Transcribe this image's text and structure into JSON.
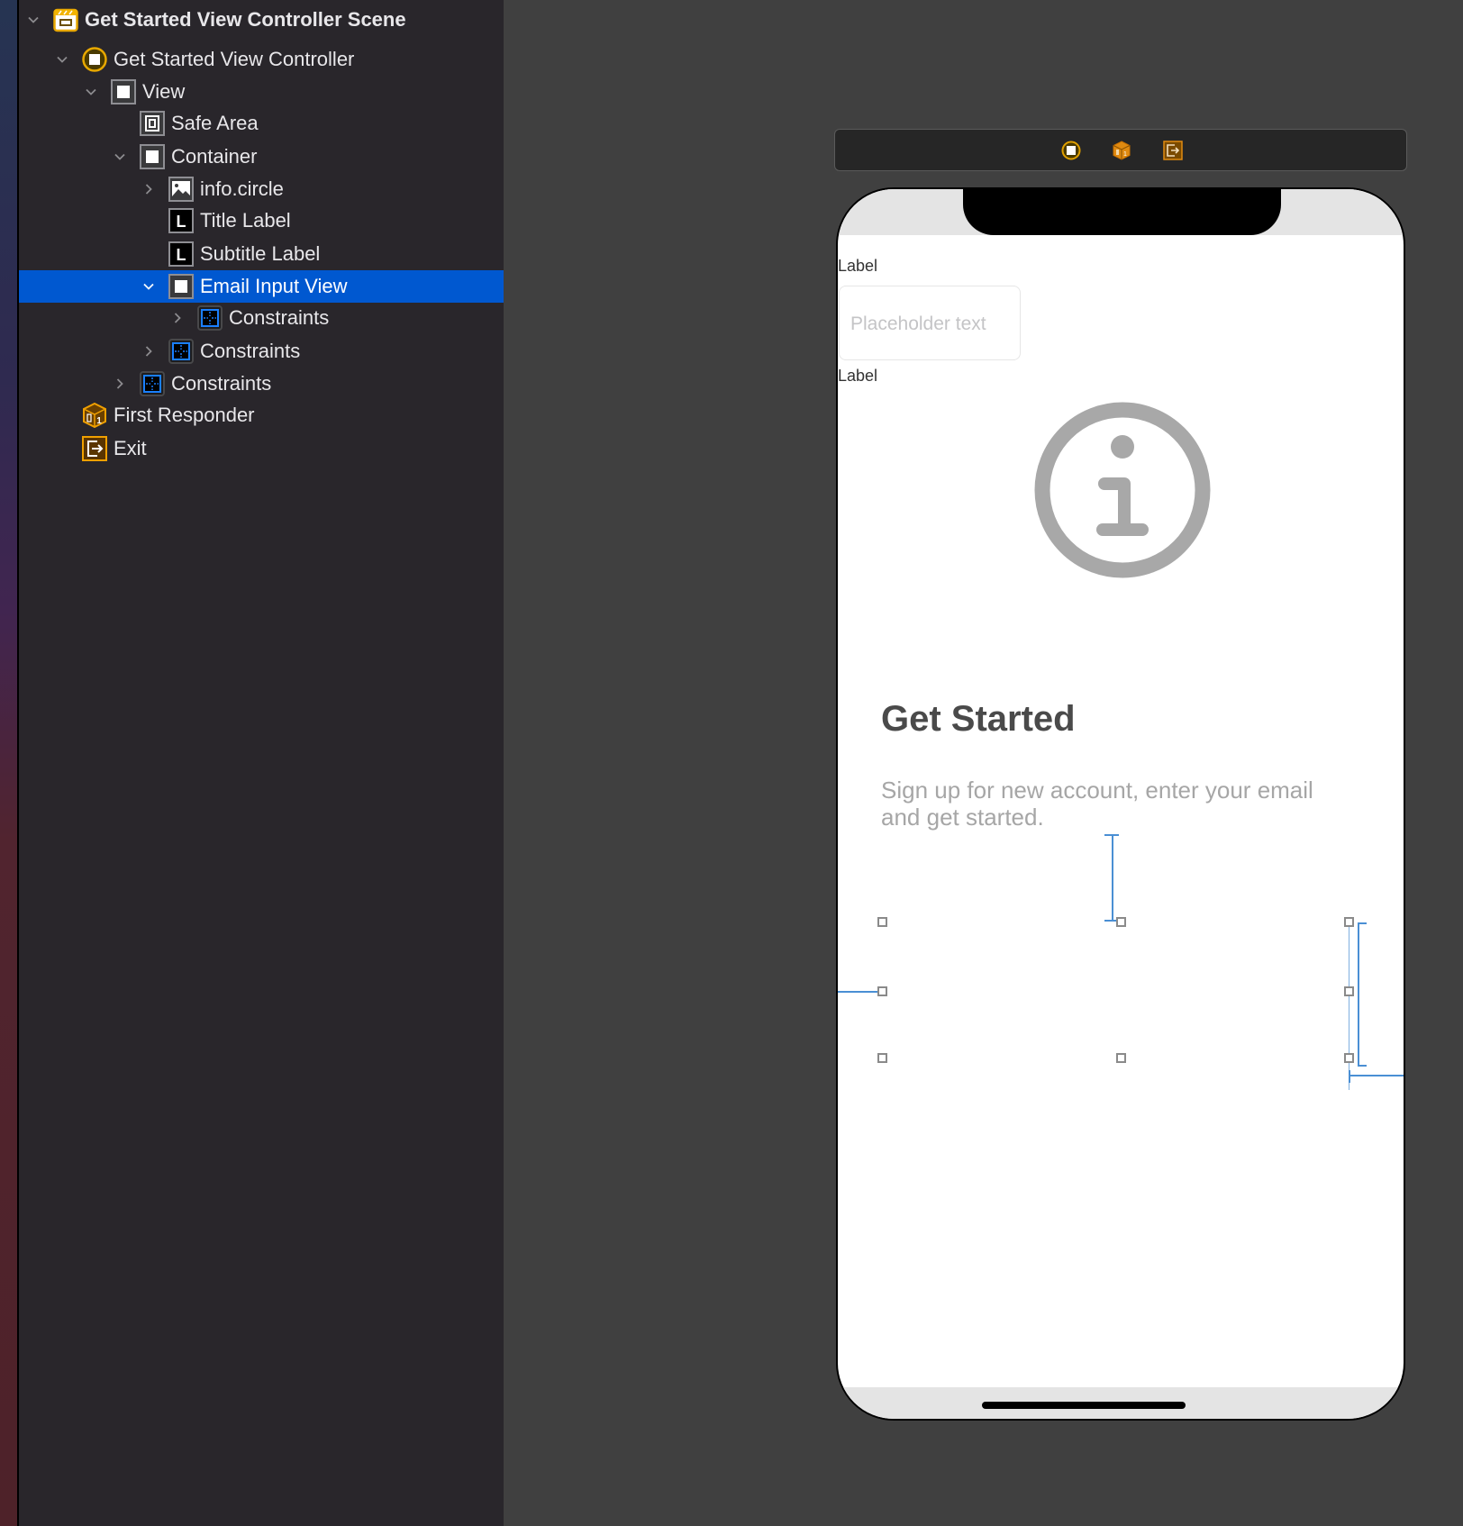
{
  "outline": {
    "items": [
      {
        "label": "Get Started View Controller Scene",
        "icon": "scene-icon",
        "expanded": true,
        "depth": 0,
        "bold": true
      },
      {
        "label": "Get Started View Controller",
        "icon": "view-controller-icon",
        "expanded": true,
        "depth": 1
      },
      {
        "label": "View",
        "icon": "view-icon",
        "expanded": true,
        "depth": 2
      },
      {
        "label": "Safe Area",
        "icon": "safe-area-icon",
        "expanded": null,
        "depth": 3
      },
      {
        "label": "Container",
        "icon": "view-icon",
        "expanded": true,
        "depth": 3
      },
      {
        "label": "info.circle",
        "icon": "image-view-icon",
        "expanded": false,
        "depth": 4
      },
      {
        "label": "Title Label",
        "icon": "label-icon",
        "expanded": null,
        "depth": 4
      },
      {
        "label": "Subtitle Label",
        "icon": "label-icon",
        "expanded": null,
        "depth": 4
      },
      {
        "label": "Email Input View",
        "icon": "view-icon",
        "expanded": true,
        "depth": 4,
        "selected": true
      },
      {
        "label": "Constraints",
        "icon": "constraints-icon",
        "expanded": false,
        "depth": 5
      },
      {
        "label": "Constraints",
        "icon": "constraints-icon",
        "expanded": false,
        "depth": 4
      },
      {
        "label": "Constraints",
        "icon": "constraints-icon",
        "expanded": false,
        "depth": 3
      },
      {
        "label": "First Responder",
        "icon": "first-responder-icon",
        "expanded": null,
        "depth": 1
      },
      {
        "label": "Exit",
        "icon": "exit-icon",
        "expanded": null,
        "depth": 1
      }
    ],
    "label_icon_glyph": "L"
  },
  "scene_toolbar": {
    "icons": [
      "view-controller-icon",
      "first-responder-icon",
      "exit-icon"
    ]
  },
  "canvas": {
    "top_label": "Label",
    "text_field": {
      "value": "",
      "placeholder": "Placeholder text"
    },
    "bottom_label": "Label",
    "image_name": "info.circle",
    "title": "Get Started",
    "subtitle": "Sign up for new account, enter your email and get started."
  },
  "colors": {
    "selection": "#0058d0",
    "accent_orange": "#f0a500",
    "constraint_blue": "#4a8fd4",
    "sidebar_bg": "#29262b",
    "canvas_bg": "#404040"
  }
}
